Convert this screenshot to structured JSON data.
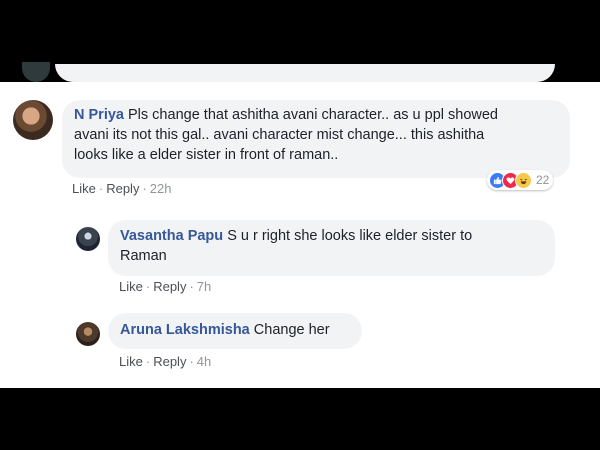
{
  "comment": {
    "author": "N Priya",
    "text": "Pls change that ashitha avani character.. as u ppl showed",
    "line2": "avani its not this gal.. avani character mist change... this ashitha",
    "line3": "looks like a elder sister in front of raman..",
    "like_label": "Like",
    "reply_label": "Reply",
    "time": "22h",
    "reaction_count": "22"
  },
  "replies": [
    {
      "author": "Vasantha Papu",
      "text": "S u r right she looks like elder sister to",
      "line2": "Raman",
      "like_label": "Like",
      "reply_label": "Reply",
      "time": "7h"
    },
    {
      "author": "Aruna Lakshmisha",
      "text": "Change her",
      "like_label": "Like",
      "reply_label": "Reply",
      "time": "4h"
    }
  ],
  "colors": {
    "name": "#365899",
    "bubble": "#f2f3f5",
    "like_reaction": "#3b7cf6",
    "love_reaction": "#f0284a",
    "haha_reaction": "#f7c94a"
  }
}
